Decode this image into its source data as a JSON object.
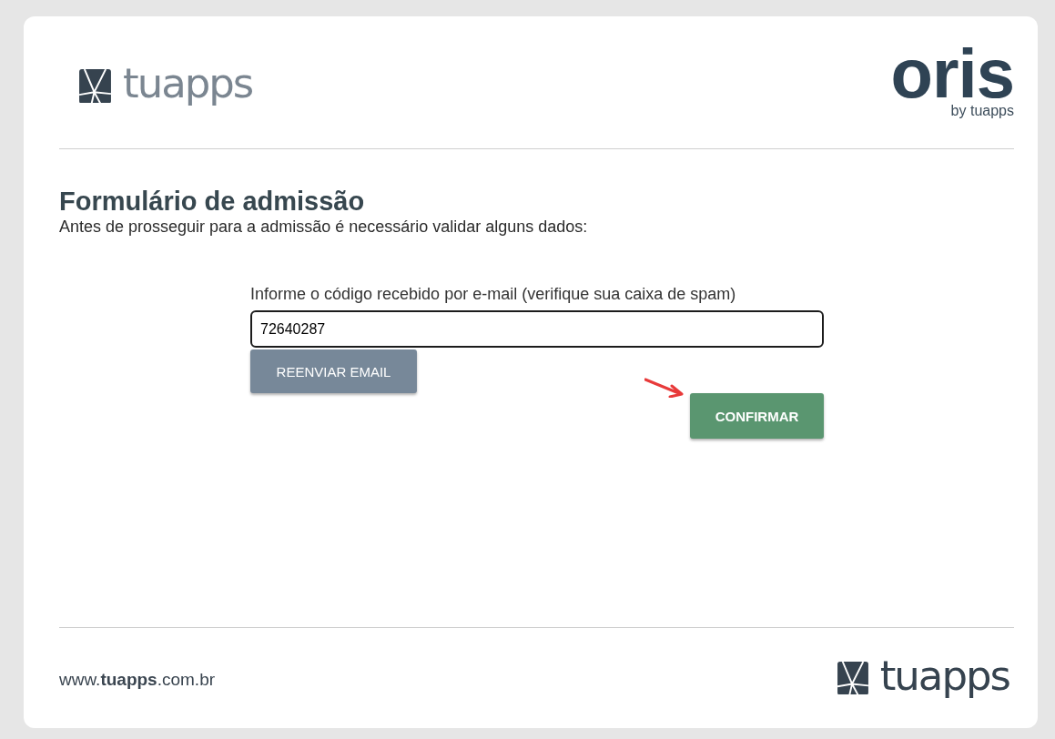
{
  "header": {
    "logo": {
      "text": "tuapps"
    },
    "product_logo": {
      "name": "oris",
      "tagline": "by tuapps"
    }
  },
  "form": {
    "title": "Formulário de admissão",
    "subtitle": "Antes de prosseguir para a admissão é necessário validar alguns dados:",
    "code_field": {
      "label": "Informe o código recebido por e-mail (verifique sua caixa de spam)",
      "value": "72640287",
      "focused": true
    },
    "buttons": [
      {
        "label": "REENVIAR EMAIL",
        "kind": "secondary"
      },
      {
        "label": "CONFIRMAR",
        "kind": "primary"
      }
    ]
  },
  "footer": {
    "url": "www.**tuapps**.com.br",
    "logo": {
      "text": "tuapps"
    }
  }
}
